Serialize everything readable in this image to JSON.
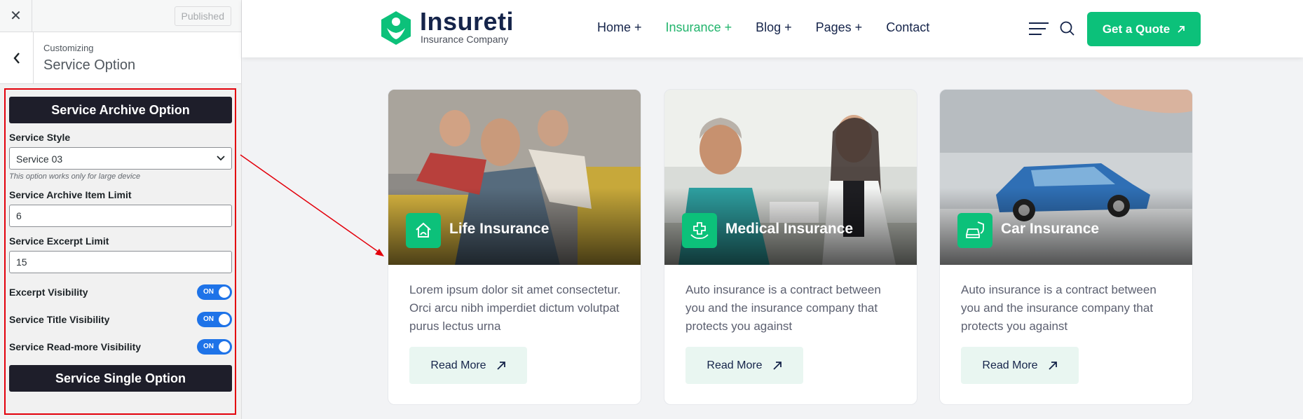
{
  "customizer": {
    "close_icon": "close-icon",
    "published_label": "Published",
    "breadcrumb": "Customizing",
    "section_title": "Service Option",
    "archive_header": "Service Archive Option",
    "service_style_label": "Service Style",
    "service_style_value": "Service 03",
    "service_style_note": "This option works only for large device",
    "item_limit_label": "Service Archive Item Limit",
    "item_limit_value": "6",
    "excerpt_limit_label": "Service Excerpt Limit",
    "excerpt_limit_value": "15",
    "toggles": [
      {
        "label": "Excerpt Visibility",
        "state": "ON"
      },
      {
        "label": "Service Title Visibility",
        "state": "ON"
      },
      {
        "label": "Service Read-more Visibility",
        "state": "ON"
      }
    ],
    "single_header": "Service Single Option"
  },
  "site": {
    "brand": "Insureti",
    "tagline": "Insurance Company",
    "nav": [
      "Home +",
      "Insurance +",
      "Blog +",
      "Pages +",
      "Contact"
    ],
    "active_nav": "Insurance +",
    "cta": "Get a Quote",
    "accent_color": "#0cc17a",
    "cards": [
      {
        "title": "Life Insurance",
        "icon": "house-hand-icon",
        "text": "Lorem ipsum dolor sit amet consectetur. Orci arcu nibh imperdiet dictum volutpat purus lectus urna",
        "button": "Read More"
      },
      {
        "title": "Medical Insurance",
        "icon": "medical-hand-icon",
        "text": "Auto insurance is a contract between you and the insurance company that protects you against",
        "button": "Read More"
      },
      {
        "title": "Car Insurance",
        "icon": "car-shield-icon",
        "text": "Auto insurance is a contract between you and the insurance company that protects you against",
        "button": "Read More"
      }
    ]
  }
}
